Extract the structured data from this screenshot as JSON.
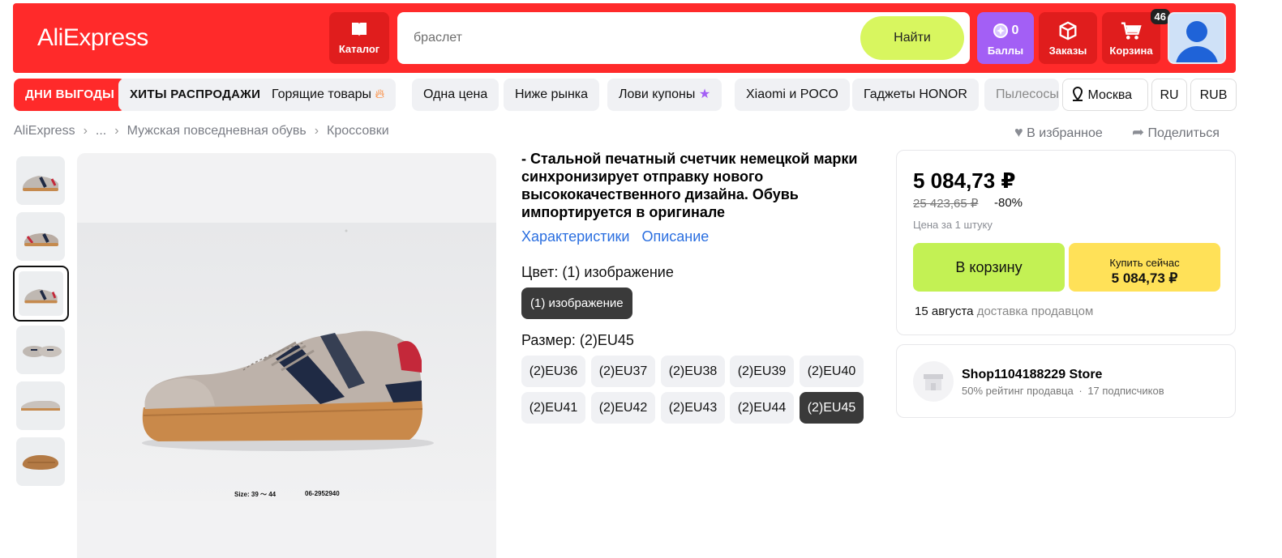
{
  "header": {
    "logo": "AliExpress",
    "catalog_label": "Каталог",
    "search_placeholder": "браслет",
    "search_button": "Найти",
    "points_value": "0",
    "points_label": "Баллы",
    "orders_label": "Заказы",
    "cart_label": "Корзина",
    "cart_count": "46"
  },
  "nav": {
    "items": [
      "ДНИ ВЫГОДЫ",
      "ХИТЫ РАСПРОДАЖИ",
      "Горящие товары",
      "Одна цена",
      "Ниже рынка",
      "Лови купоны",
      "Xiaomi и POCO",
      "Гаджеты HONOR",
      "Пылесосы"
    ],
    "location": "Москва",
    "language": "RU",
    "currency": "RUB"
  },
  "breadcrumb": [
    "AliExpress",
    "...",
    "Мужская повседневная обувь",
    "Кроссовки"
  ],
  "actions": {
    "favorite": "В избранное",
    "share": "Поделиться"
  },
  "product": {
    "title": "- Стальной печатный счетчик немецкой марки синхронизирует отправку нового высококачественного дизайна. Обувь импортируется в оригинале",
    "tab_specs": "Характеристики",
    "tab_description": "Описание",
    "color_label": "Цвет: (1) изображение",
    "color_option": "(1) изображение",
    "size_label": "Размер: (2)EU45",
    "sizes": [
      "(2)EU36",
      "(2)EU37",
      "(2)EU38",
      "(2)EU39",
      "(2)EU40",
      "(2)EU41",
      "(2)EU42",
      "(2)EU43",
      "(2)EU44",
      "(2)EU45"
    ],
    "selected_size": "(2)EU45",
    "image_caption_left": "Size: 39 ～ 44",
    "image_caption_right": "06-2952940",
    "thumbnail_count": 6,
    "selected_thumbnail": 3
  },
  "purchase": {
    "price": "5 084,73 ₽",
    "old_price": "25 423,65 ₽",
    "discount": "-80%",
    "unit_note": "Цена за 1 штуку",
    "add_to_cart": "В корзину",
    "buy_now": "Купить сейчас",
    "buy_now_price": "5 084,73 ₽",
    "delivery_date": "15 августа",
    "delivery_by": "доставка продавцом"
  },
  "store": {
    "name": "Shop1104188229 Store",
    "rating": "50% рейтинг продавца",
    "separator": "·",
    "subscribers": "17 подписчиков"
  },
  "colors": {
    "header_red": "#ff2a2a",
    "search_button": "#d8f65f",
    "points_purple": "#a35ff5",
    "link_blue": "#2b6fe0",
    "cart_button_green": "#c3f154",
    "buy_button_yellow": "#ffe158",
    "selected_chip": "#3a3a3a"
  },
  "icons": [
    "book-icon",
    "coin-icon",
    "box-icon",
    "cart-icon",
    "user-avatar",
    "fire-icon",
    "star-icon",
    "pin-icon",
    "heart-icon",
    "share-arrow-icon",
    "store-icon",
    "chevron-right-icon"
  ]
}
